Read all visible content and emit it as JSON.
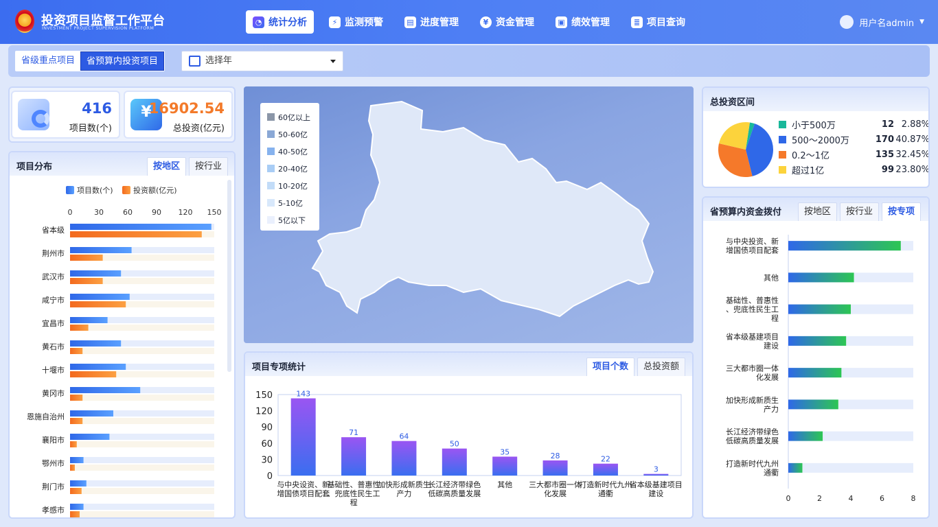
{
  "header": {
    "title": "投资项目监督工作平台",
    "subtitle": "INVESTMENT PROJECT SUPERVISION PLATFORM",
    "nav": [
      {
        "label": "统计分析",
        "active": true
      },
      {
        "label": "监测预警",
        "active": false
      },
      {
        "label": "进度管理",
        "active": false
      },
      {
        "label": "资金管理",
        "active": false
      },
      {
        "label": "绩效管理",
        "active": false
      },
      {
        "label": "项目查询",
        "active": false
      }
    ],
    "user": "用户名admin"
  },
  "filters": {
    "segments": [
      "省级重点项目",
      "省预算内投资项目"
    ],
    "active_segment": "省预算内投资项目",
    "year_placeholder": "选择年"
  },
  "kpis": [
    {
      "value": "416",
      "label": "项目数(个)"
    },
    {
      "value": "16902.54",
      "label": "总投资(亿元)"
    }
  ],
  "distribution": {
    "title": "项目分布",
    "tabs": [
      "按地区",
      "按行业"
    ],
    "active_tab": "按地区",
    "chart_data": {
      "type": "bar",
      "orientation": "horizontal",
      "categories": [
        "省本级",
        "荆州市",
        "武汉市",
        "咸宁市",
        "宜昌市",
        "黄石市",
        "十堰市",
        "黄冈市",
        "恩施自治州",
        "襄阳市",
        "鄂州市",
        "荆门市",
        "孝感市"
      ],
      "series": [
        {
          "name": "项目数(个)",
          "values": [
            147,
            64,
            53,
            62,
            39,
            53,
            58,
            73,
            45,
            41,
            14,
            17,
            14
          ]
        },
        {
          "name": "投资额(亿元)",
          "values": [
            137,
            34,
            34,
            58,
            19,
            13,
            48,
            13,
            13,
            7,
            5,
            12,
            10
          ]
        }
      ],
      "ticks": [
        "0",
        "30",
        "60",
        "90",
        "120",
        "150"
      ],
      "xlim": [
        0,
        150
      ],
      "legend": "top"
    }
  },
  "map": {
    "legend": [
      {
        "label": "60亿以上",
        "color": "#8b96a8"
      },
      {
        "label": "50-60亿",
        "color": "#8aa8d6"
      },
      {
        "label": "40-50亿",
        "color": "#86b2ee"
      },
      {
        "label": "20-40亿",
        "color": "#a9cdf5"
      },
      {
        "label": "10-20亿",
        "color": "#c2dcf8"
      },
      {
        "label": "5-10亿",
        "color": "#d8e8fb"
      },
      {
        "label": "5亿以下",
        "color": "#eaf0fd"
      }
    ]
  },
  "special": {
    "title": "项目专项统计",
    "tabs": [
      "项目个数",
      "总投资额"
    ],
    "active_tab": "项目个数",
    "chart_data": {
      "type": "bar",
      "categories": [
        "与中央设资、新增国债项目配套",
        "基础性、普惠性、兜底性民生工程",
        "加快形成新质生产力",
        "长江经济带绿色低碳高质量发展",
        "其他",
        "三大都市圈一体化发展",
        "打造新时代九州通衢",
        "省本级基建项目建设"
      ],
      "values": [
        143,
        71,
        64,
        50,
        35,
        28,
        22,
        3
      ],
      "ticks": [
        "0",
        "30",
        "60",
        "90",
        "120",
        "150"
      ],
      "ylim": [
        0,
        150
      ],
      "grid": false
    }
  },
  "range": {
    "title": "总投资区间",
    "chart_data": {
      "type": "pie",
      "categories": [
        "小于500万",
        "500～2000万",
        "0.2～1亿",
        "超过1亿"
      ],
      "values": [
        12,
        170,
        135,
        99
      ],
      "percents": [
        "2.88%",
        "40.87%",
        "32.45%",
        "23.80%"
      ],
      "colors": [
        "#19b89a",
        "#2f68e8",
        "#f5792a",
        "#fcd33c"
      ]
    }
  },
  "funding": {
    "title": "省预算内资金拨付",
    "tabs": [
      "按地区",
      "按行业",
      "按专项"
    ],
    "active_tab": "按专项",
    "chart_data": {
      "type": "bar",
      "orientation": "horizontal",
      "categories": [
        "与中央投资、新增国债项目配套",
        "其他",
        "基础性、普惠性、兜底性民生工程",
        "省本级基建项目建设",
        "三大都市圈一体化发展",
        "加快形成新质生产力",
        "长江经济带绿色低碳高质量发展",
        "打造新时代九州通衢"
      ],
      "values": [
        7.2,
        4.2,
        4.0,
        3.7,
        3.4,
        3.2,
        2.2,
        0.9
      ],
      "ticks": [
        "0",
        "2",
        "4",
        "6",
        "8"
      ],
      "xlim": [
        0,
        8
      ]
    }
  }
}
